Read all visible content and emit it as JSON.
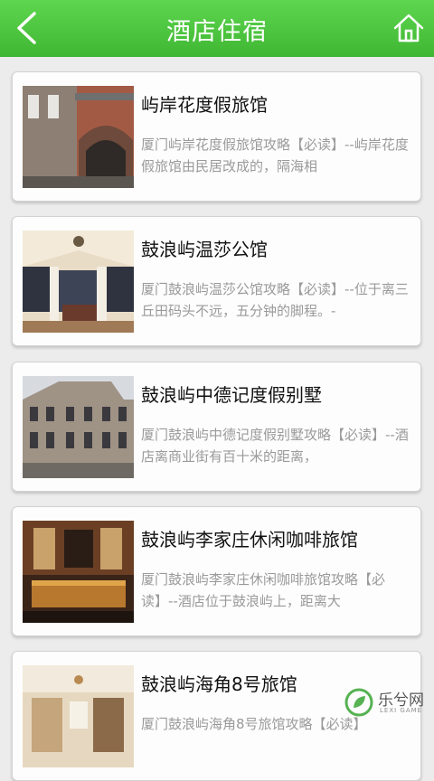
{
  "header": {
    "title": "酒店住宿",
    "back_icon": "chevron-left-icon",
    "home_icon": "home-icon"
  },
  "hotels": [
    {
      "name": "屿岸花度假旅馆",
      "desc": "厦门屿岸花度假旅馆攻略【必读】--屿岸花度假旅馆由民居改成的，隔海相"
    },
    {
      "name": "鼓浪屿温莎公馆",
      "desc": "厦门鼓浪屿温莎公馆攻略【必读】--位于离三丘田码头不远，五分钟的脚程。-"
    },
    {
      "name": "鼓浪屿中德记度假别墅",
      "desc": "厦门鼓浪屿中德记度假别墅攻略【必读】--酒店离商业街有百十米的距离，"
    },
    {
      "name": "鼓浪屿李家庄休闲咖啡旅馆",
      "desc": "厦门鼓浪屿李家庄休闲咖啡旅馆攻略【必读】--酒店位于鼓浪屿上，距离大"
    },
    {
      "name": "鼓浪屿海角8号旅馆",
      "desc": "厦门鼓浪屿海角8号旅馆攻略【必读】"
    }
  ],
  "watermark": {
    "text": "乐兮网",
    "sub": "LEXI GAME"
  },
  "colors": {
    "header_green": "#4cc33c",
    "desc_gray": "#9a9a9a"
  }
}
